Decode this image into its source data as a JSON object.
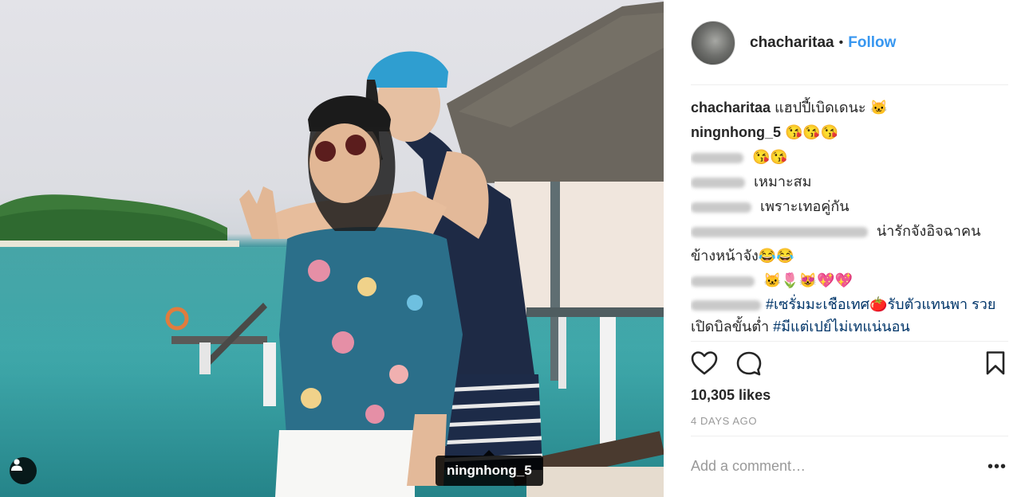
{
  "post": {
    "username": "chacharitaa",
    "separator": "•",
    "follow_label": "Follow",
    "photo_tag": "ningnhong_5",
    "likes": "10,305 likes",
    "age": "4 DAYS AGO",
    "comment_placeholder": "Add a comment…",
    "more_label": "•••"
  },
  "comments": [
    {
      "user": "chacharitaa",
      "text": " แฮปปี้เบิดเดนะ 🐱"
    },
    {
      "user": "ningnhong_5",
      "text": " 😘😘😘"
    },
    {
      "user_blurred": true,
      "text": " 😘😘"
    },
    {
      "user_blurred": true,
      "text": " เหมาะสม"
    },
    {
      "user_blurred": true,
      "text": " เพราะเทอคู่กัน"
    },
    {
      "user_blurred": true,
      "text": " น่ารักจังอิจฉาคน ข้างหน้าจัง😂😂"
    },
    {
      "user_blurred": true,
      "text": " 🐱🌷😻💖💖"
    },
    {
      "user_blurred": true,
      "hashtag_1": "#เซรั่มมะเชือเทศ🍅รับตัวแทนพา รวย",
      "text_mid": " เปิดบิลขั้นต่ำ ",
      "hashtag_2": "#มีแต่เปย์ไม่เทแน่นอน"
    }
  ],
  "icons": {
    "like": "heart-icon",
    "comment": "comment-bubble-icon",
    "save": "bookmark-icon",
    "user_tag": "person-tag-icon"
  },
  "colors": {
    "accent": "#3897f0",
    "hashtag": "#003569",
    "muted": "#999999"
  }
}
